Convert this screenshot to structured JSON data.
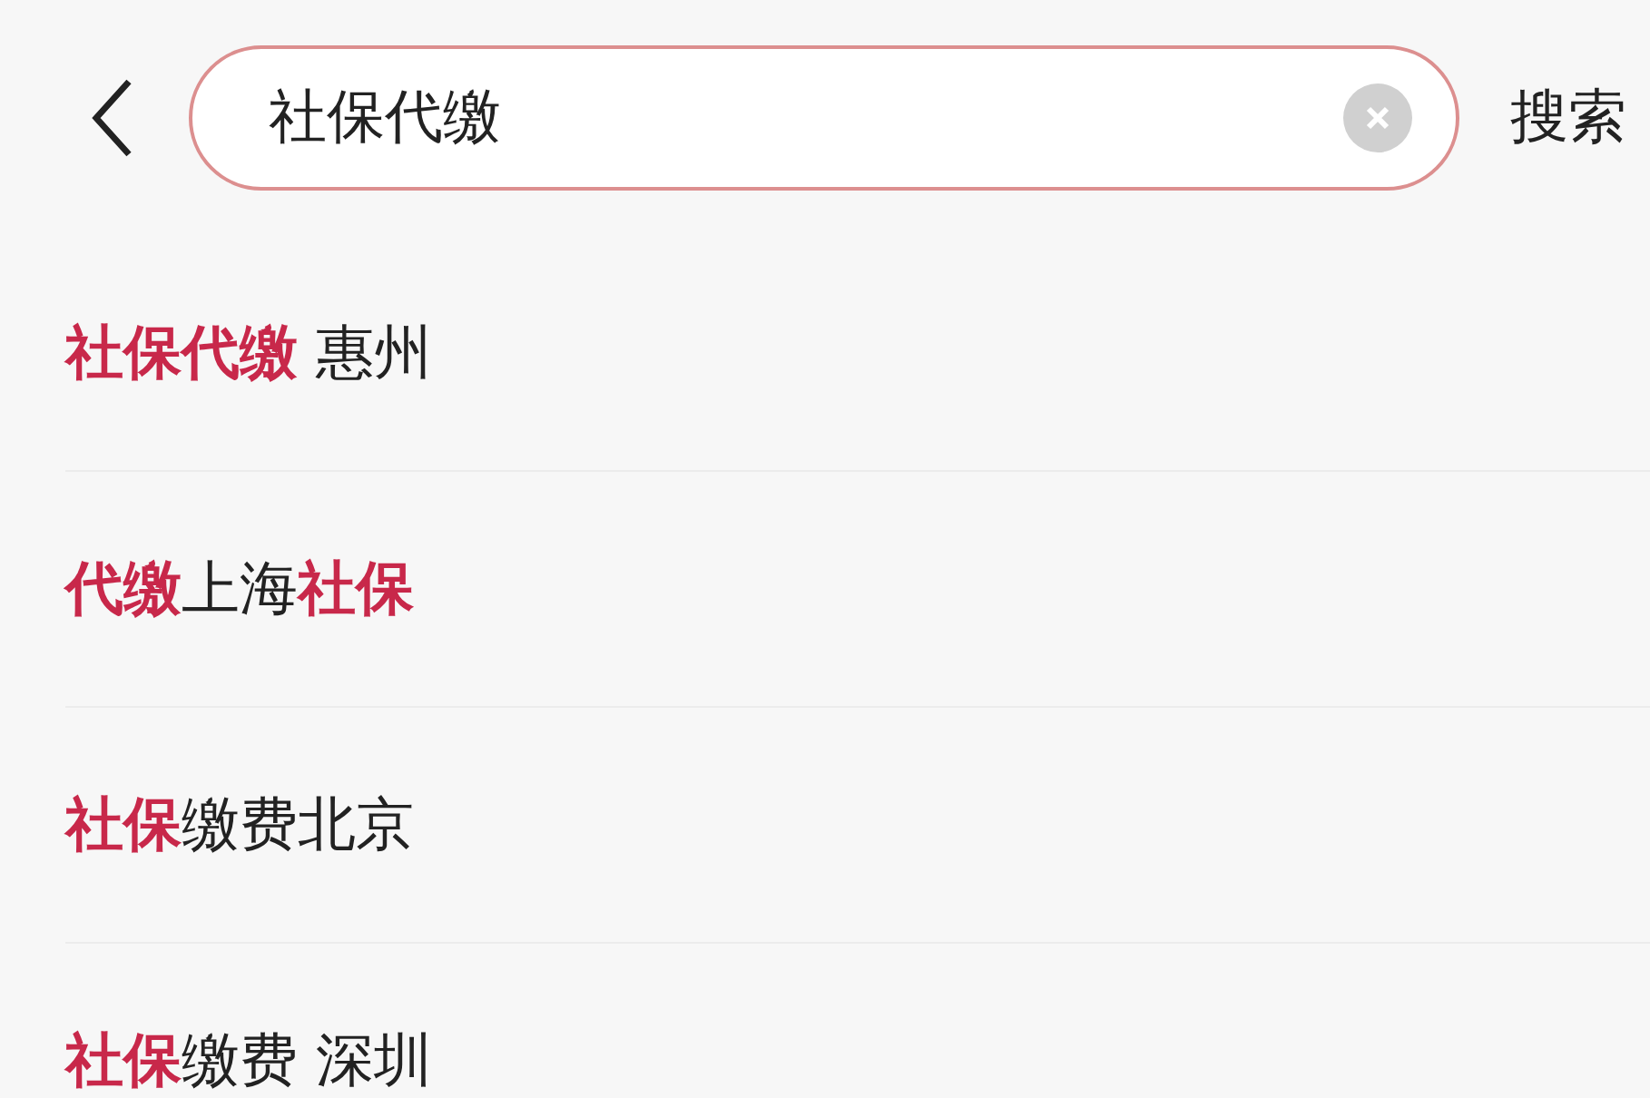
{
  "search": {
    "value": "社保代缴",
    "button": "搜索"
  },
  "suggestions": [
    {
      "text": "**社保代缴** 惠州"
    },
    {
      "text": "**代缴**上海**社保**"
    },
    {
      "text": "**社保**缴费北京"
    },
    {
      "text": "**社保**缴费 深圳"
    }
  ]
}
